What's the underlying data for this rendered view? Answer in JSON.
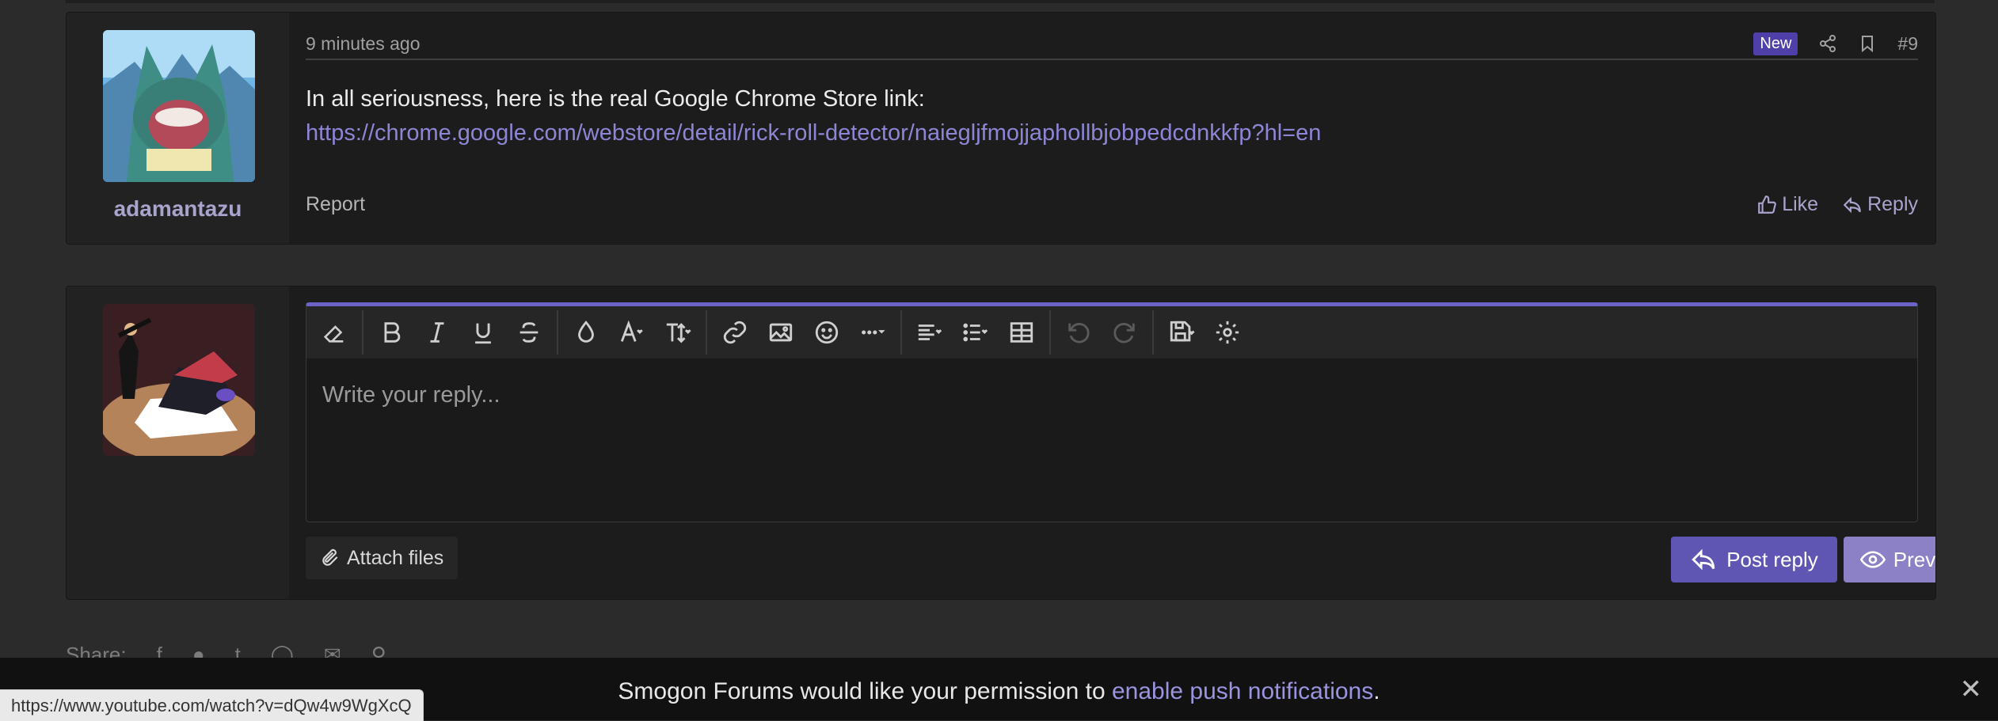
{
  "post": {
    "username": "adamantazu",
    "timestamp": "9 minutes ago",
    "badge": "New",
    "post_number": "#9",
    "body_line1": "In all seriousness, here is the real Google Chrome Store link:",
    "link": "https://chrome.google.com/webstore/detail/rick-roll-detector/naiegljfmojjaphollbjobpedcdnkkfp?hl=en",
    "report_label": "Report",
    "like_label": "Like",
    "reply_label": "Reply"
  },
  "reply_form": {
    "placeholder": "Write your reply...",
    "attach_label": "Attach files",
    "post_reply_label": "Post reply",
    "preview_label": "Preview",
    "toolbar_icons": [
      "eraser-icon",
      "bold-icon",
      "italic-icon",
      "underline-icon",
      "strikethrough-icon",
      "text-color-icon",
      "font-family-icon",
      "font-size-icon",
      "link-icon",
      "image-icon",
      "emoji-icon",
      "more-icon",
      "align-icon",
      "list-icon",
      "table-icon",
      "undo-icon",
      "redo-icon",
      "drafts-icon",
      "settings-icon"
    ]
  },
  "share": {
    "label": "Share:"
  },
  "push_banner": {
    "text_before": "Smogon Forums would like your permission to ",
    "link_text": "enable push notifications",
    "text_after": "."
  },
  "status_bar": {
    "url": "https://www.youtube.com/watch?v=dQw4w9WgXcQ"
  },
  "colors": {
    "accent": "#6c63c9",
    "link": "#8c86d6",
    "post_button": "#5e56b2",
    "preview_button": "#8c80c6",
    "badge": "#4f3fa8"
  }
}
